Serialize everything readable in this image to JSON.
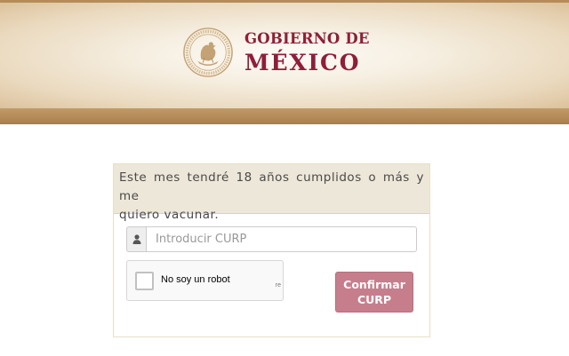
{
  "header": {
    "logo_line1": "GOBIERNO DE",
    "logo_line2": "MÉXICO",
    "brand_color": "#8f1e39",
    "seal_icon": "coat-of-arms-seal-icon"
  },
  "form": {
    "heading_line1": "Este mes tendré 18 años cumplidos o más y me",
    "heading_line2": "quiero vacunar.",
    "curp_input": {
      "placeholder": "Introducir CURP",
      "value": "",
      "icon": "user-icon"
    },
    "recaptcha": {
      "label": "No soy un robot",
      "checked": false
    },
    "confirm_button_label": "Confirmar\nCURP",
    "button_color": "#c67e8d"
  }
}
